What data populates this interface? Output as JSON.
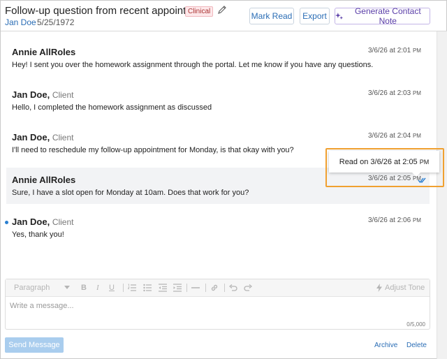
{
  "header": {
    "title": "Follow-up question from recent appointment",
    "badge": "Clinical",
    "client_name": "Jan Doe",
    "client_dob": "5/25/1972",
    "mark_read_label": "Mark Read",
    "export_label": "Export",
    "generate_label": "Generate Contact Note"
  },
  "messages": [
    {
      "sender": "Annie AllRoles",
      "role": "",
      "date": "3/6/26 at 2:01",
      "ampm": "PM",
      "text": "Hey! I sent you over the homework assignment through the portal. Let me know if you have any questions."
    },
    {
      "sender": "Jan Doe,",
      "role": "Client",
      "date": "3/6/26 at 2:03",
      "ampm": "PM",
      "text": "Hello, I completed the homework assignment as discussed"
    },
    {
      "sender": "Jan Doe,",
      "role": "Client",
      "date": "3/6/26 at 2:04",
      "ampm": "PM",
      "text": "I'll need to reschedule my follow-up appointment for Monday, is that okay with you?"
    },
    {
      "sender": "Annie AllRoles",
      "role": "",
      "date": "3/6/26 at 2:05",
      "ampm": "PM",
      "text": "Sure, I have a slot open for Monday at 10am. Does that work for you?"
    },
    {
      "sender": "Jan Doe,",
      "role": "Client",
      "date": "3/6/26 at 2:06",
      "ampm": "PM",
      "text": "Yes, thank you!"
    }
  ],
  "tooltip": {
    "text": "Read on 3/6/26 at 2:05",
    "ampm": "PM"
  },
  "editor": {
    "paragraph_label": "Paragraph",
    "adjust_tone_label": "Adjust Tone",
    "placeholder": "Write a message...",
    "counter": "0/5,000"
  },
  "footer": {
    "send_label": "Send Message",
    "archive_label": "Archive",
    "delete_label": "Delete"
  },
  "colors": {
    "accent": "#2a6db5",
    "highlight": "#f0a030",
    "clinical_badge": "#fde8ea"
  }
}
